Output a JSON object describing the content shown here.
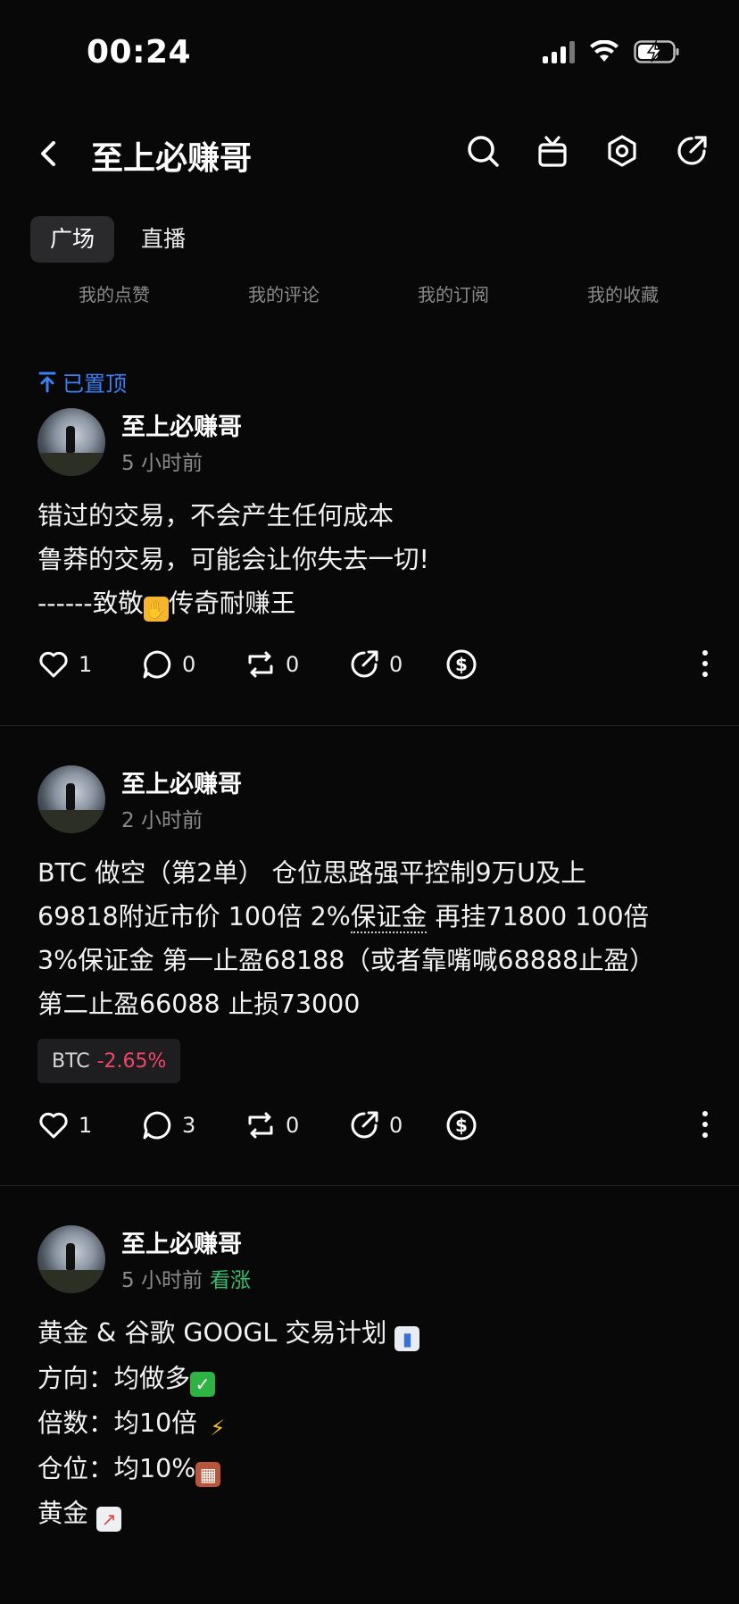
{
  "status": {
    "time": "00:24"
  },
  "nav": {
    "title": "至上必赚哥"
  },
  "tabs": [
    {
      "label": "广场"
    },
    {
      "label": "直播"
    }
  ],
  "quick_links": [
    "我的点赞",
    "我的评论",
    "我的订阅",
    "我的收藏"
  ],
  "colors": {
    "accent_blue": "#3b7ff5",
    "bullish_green": "#2fbf71",
    "bearish_red": "#f2456a"
  },
  "posts": [
    {
      "pinned_label": "已置顶",
      "author": "至上必赚哥",
      "time": "5 小时前",
      "lines": [
        "错过的交易，不会产生任何成本",
        "鲁莽的交易，可能会让你失去一切!",
        "------致敬",
        "传奇耐赚王"
      ],
      "likes": "1",
      "comments": "0",
      "reposts": "0",
      "shares": "0"
    },
    {
      "author": "至上必赚哥",
      "time": "2 小时前",
      "lines": [
        "BTC 做空（第2单） 仓位思路强平控制9万U及上",
        "69818附近市价 100倍 2%",
        "保证金",
        " 再挂71800 100倍",
        "3%保证金 第一止盈68188（或者靠嘴喊68888止盈）",
        "第二止盈66088 止损73000"
      ],
      "ticker": {
        "symbol": "BTC",
        "change": "-2.65%"
      },
      "likes": "1",
      "comments": "3",
      "reposts": "0",
      "shares": "0"
    },
    {
      "author": "至上必赚哥",
      "time": "5 小时前",
      "sentiment": "看涨",
      "lines": [
        "黄金 & 谷歌 GOOGL 交易计划",
        "方向：均做多",
        "倍数：均10倍",
        "仓位：均10%",
        "黄金"
      ]
    }
  ]
}
